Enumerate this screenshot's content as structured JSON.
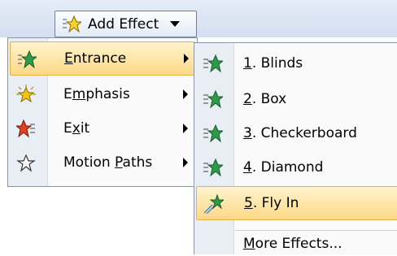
{
  "button": {
    "label": "Add Effect"
  },
  "menu": {
    "items": [
      {
        "label": "Entrance",
        "mnemonic": "E",
        "rest": "ntrance",
        "icon": "entrance-star-icon",
        "highlighted": true
      },
      {
        "label": "Emphasis",
        "pre": "E",
        "mnemonic": "m",
        "rest": "phasis",
        "icon": "emphasis-star-icon"
      },
      {
        "label": "Exit",
        "pre": "E",
        "mnemonic": "x",
        "rest": "it",
        "icon": "exit-star-icon"
      },
      {
        "label": "Motion Paths",
        "pre": "Motion ",
        "mnemonic": "P",
        "rest": "aths",
        "icon": "motion-paths-star-icon"
      }
    ]
  },
  "submenu": {
    "items": [
      {
        "num": "1",
        "rest": ". Blinds",
        "icon": "blinds-star-icon"
      },
      {
        "num": "2",
        "rest": ". Box",
        "icon": "box-star-icon"
      },
      {
        "num": "3",
        "rest": ". Checkerboard",
        "icon": "checkerboard-star-icon"
      },
      {
        "num": "4",
        "rest": ". Diamond",
        "icon": "diamond-star-icon"
      },
      {
        "num": "5",
        "rest": ". Fly In",
        "icon": "fly-in-star-icon",
        "highlighted": true
      }
    ],
    "more": {
      "mnemonic": "M",
      "rest": "ore Effects..."
    }
  },
  "colors": {
    "highlight": "#fdd986",
    "entrance_star": "#2e9a4a",
    "emphasis_star": "#f2c51c",
    "exit_star": "#e0421f"
  }
}
